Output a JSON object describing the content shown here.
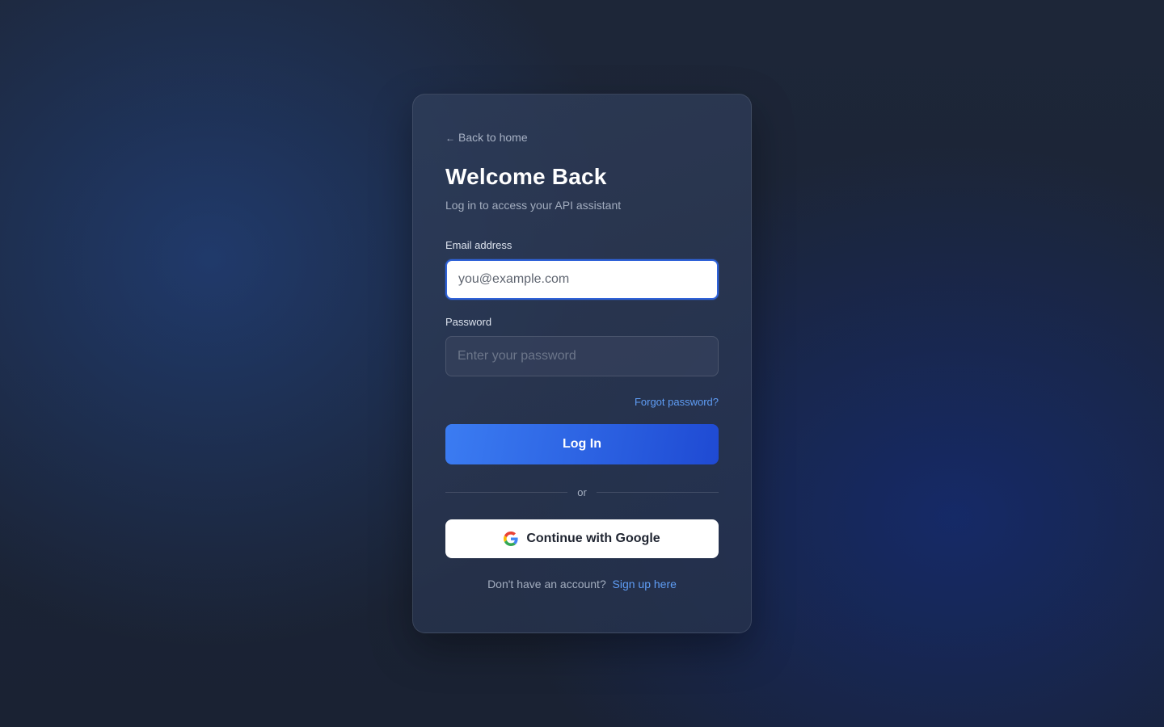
{
  "back_link": {
    "arrow": "←",
    "label": "Back to home"
  },
  "header": {
    "title": "Welcome Back",
    "subtitle": "Log in to access your API assistant"
  },
  "form": {
    "email": {
      "label": "Email address",
      "placeholder": "you@example.com",
      "value": ""
    },
    "password": {
      "label": "Password",
      "placeholder": "Enter your password",
      "value": ""
    },
    "forgot_label": "Forgot password?",
    "submit_label": "Log In"
  },
  "divider": {
    "label": "or"
  },
  "google": {
    "label": "Continue with Google",
    "icon": "google-g-icon"
  },
  "signup": {
    "prompt": "Don't have an account?",
    "link_label": "Sign up here"
  },
  "colors": {
    "accent": "#3b7cf2",
    "link": "#5f9df5",
    "background": "#1b2436",
    "card": "#2c3a55"
  }
}
